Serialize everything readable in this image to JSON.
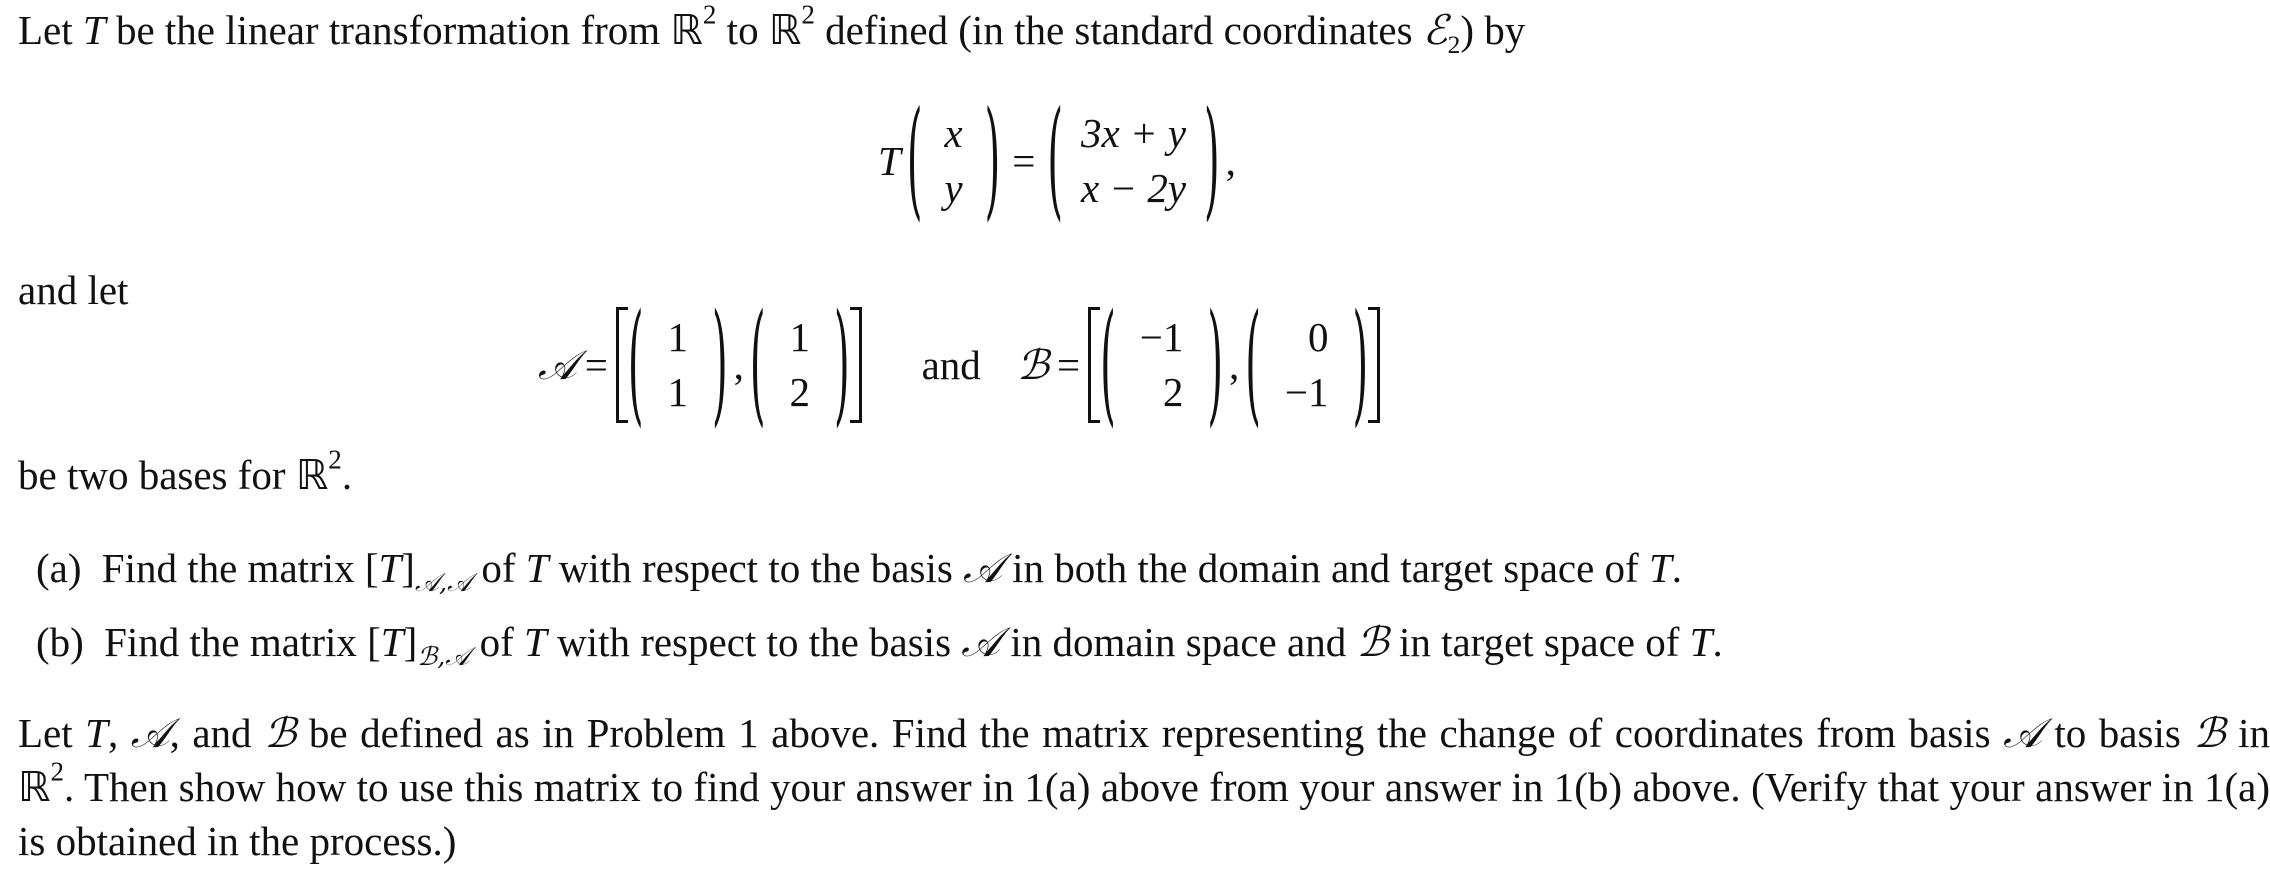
{
  "intro": {
    "p1": "Let",
    "T": "T",
    "p2": "be the linear transformation from",
    "R": "ℝ",
    "sq": "2",
    "p3": "to",
    "p4": "defined (in the standard coordinates",
    "E": "ℰ",
    "E_sub": "2",
    "p5": ") by"
  },
  "transformation": {
    "lhs_name": "T",
    "input": [
      "x",
      "y"
    ],
    "equals": "=",
    "output": [
      "3x + y",
      "x − 2y"
    ],
    "trailing": ","
  },
  "and_let": "and let",
  "bases": {
    "A": {
      "name": "𝒜",
      "vectors": [
        [
          "1",
          "1"
        ],
        [
          "1",
          "2"
        ]
      ]
    },
    "connector": "and",
    "B": {
      "name": "ℬ",
      "vectors": [
        [
          "−1",
          "2"
        ],
        [
          "0",
          "−1"
        ]
      ]
    },
    "equals": "=",
    "comma": ","
  },
  "two_bases": {
    "text": "be two bases for",
    "R": "ℝ",
    "sq": "2",
    "end": "."
  },
  "parts": [
    {
      "label": "(a)",
      "t1": "Find the matrix [",
      "T": "T",
      "t2": "]",
      "sub": "𝒜,𝒜",
      "t3": "of",
      "t4": "with respect to the basis",
      "basis": "𝒜",
      "t5": "in both the domain and target space of",
      "end": "."
    },
    {
      "label": "(b)",
      "t1": "Find the matrix [",
      "T": "T",
      "t2": "]",
      "sub": "ℬ,𝒜",
      "t3": "of",
      "t4": "with respect to the basis",
      "basis": "𝒜",
      "t5": "in domain space and",
      "basis2": "ℬ",
      "t6": "in target space of",
      "end": "."
    }
  ],
  "problem2": {
    "s1": "Let",
    "T": "T",
    "s2": ",",
    "A": "𝒜",
    "s3": ", and",
    "B": "ℬ",
    "s4": "be defined as in Problem 1 above.  Find the matrix representing the change of coordinates from basis",
    "s5": "to basis",
    "s6": "in",
    "R": "ℝ",
    "sq": "2",
    "s7": ". Then show how to use this matrix to find your answer in 1(a) above from your answer in 1(b) above. (Verify that your answer in 1(a) is obtained in the process.)"
  }
}
